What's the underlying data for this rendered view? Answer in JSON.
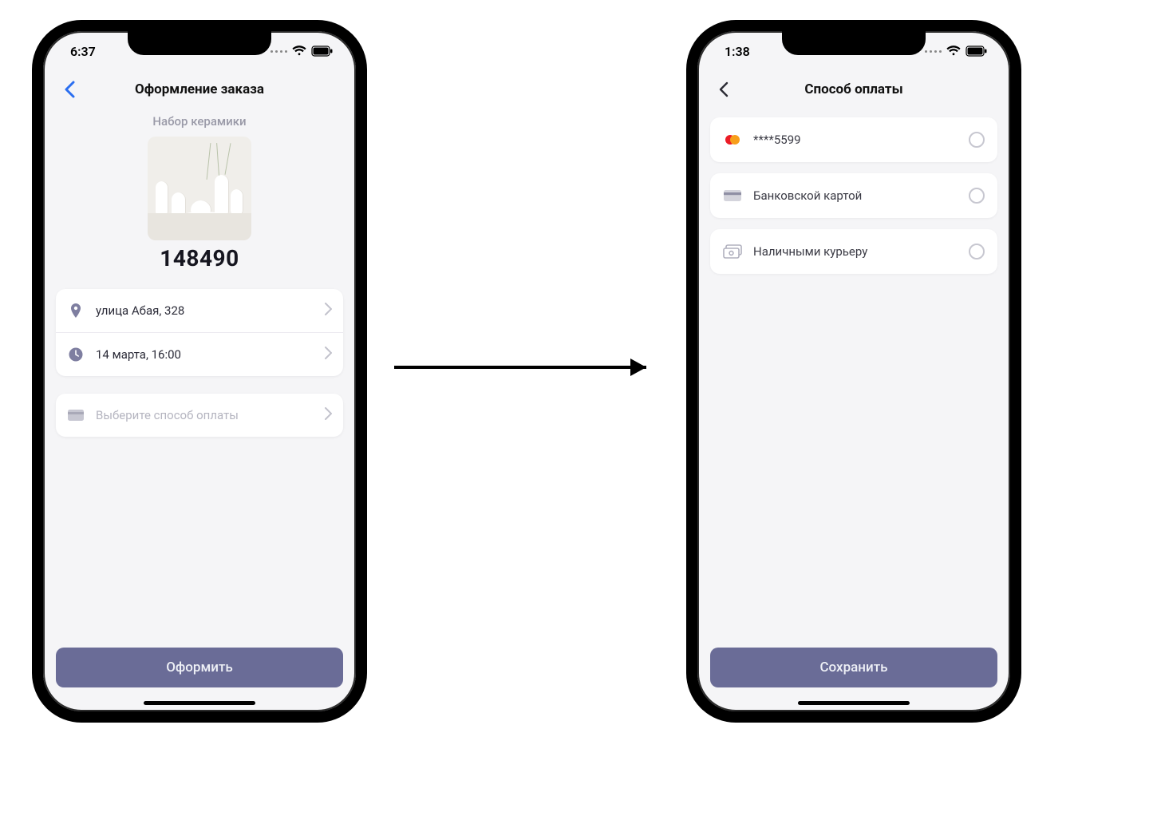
{
  "screen1": {
    "status_time": "6:37",
    "nav_title": "Оформление заказа",
    "product_name": "Набор керамики",
    "product_price": "148490",
    "rows": {
      "address": "улица Абая, 328",
      "datetime": "14 марта, 16:00",
      "payment_placeholder": "Выберите способ оплаты"
    },
    "primary_button": "Оформить"
  },
  "screen2": {
    "status_time": "1:38",
    "nav_title": "Способ оплаты",
    "options": [
      {
        "icon": "mastercard",
        "label": "****5599"
      },
      {
        "icon": "card",
        "label": "Банковской картой"
      },
      {
        "icon": "cash",
        "label": "Наличными курьеру"
      }
    ],
    "primary_button": "Сохранить"
  },
  "colors": {
    "accent": "#6a6c97",
    "back_blue": "#2a6ef0",
    "muted": "#b5b5c0"
  }
}
